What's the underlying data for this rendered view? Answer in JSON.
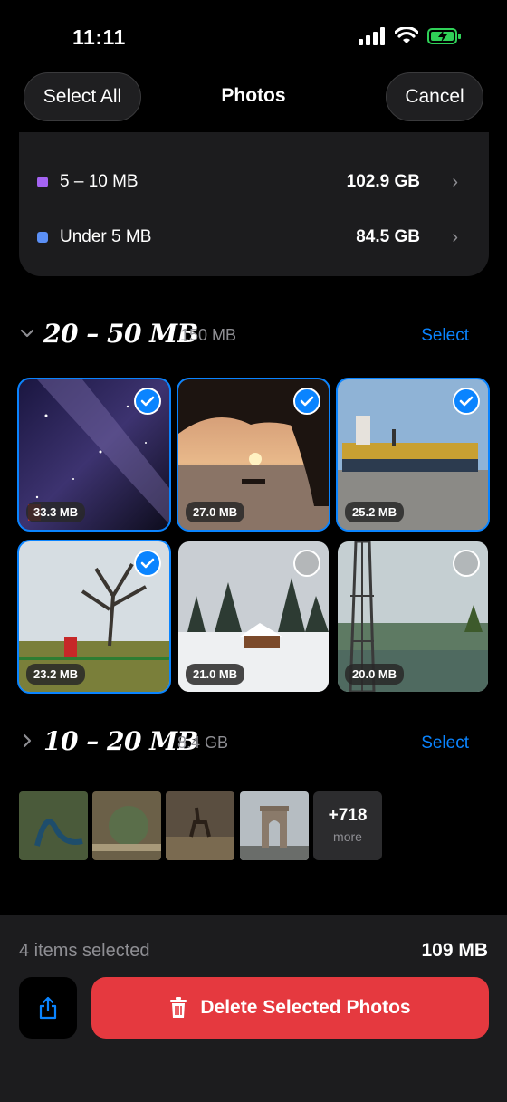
{
  "status": {
    "time": "11:11"
  },
  "nav": {
    "select_all": "Select All",
    "title": "Photos",
    "cancel": "Cancel"
  },
  "summary": [
    {
      "label": "5 – 10 MB",
      "value": "102.9 GB",
      "color": "#a463f2"
    },
    {
      "label": "Under 5 MB",
      "value": "84.5 GB",
      "color": "#5b8ff5"
    }
  ],
  "section_20_50": {
    "title": "20 – 50 MB",
    "size": "150 MB",
    "select_label": "Select",
    "photos": [
      {
        "size": "33.3 MB",
        "selected": true,
        "icon": "milky-way-photo"
      },
      {
        "size": "27.0 MB",
        "selected": true,
        "icon": "sunset-lake-photo"
      },
      {
        "size": "25.2 MB",
        "selected": true,
        "icon": "ship-photo"
      },
      {
        "size": "23.2 MB",
        "selected": true,
        "icon": "winter-tree-photo"
      },
      {
        "size": "21.0 MB",
        "selected": false,
        "icon": "snow-cabin-photo"
      },
      {
        "size": "20.0 MB",
        "selected": false,
        "icon": "power-line-lake-photo"
      }
    ]
  },
  "section_10_20": {
    "title": "10 – 20 MB",
    "size": "8.4 GB",
    "select_label": "Select",
    "more_count": "+718",
    "more_label": "more"
  },
  "bottom": {
    "selected_count": "4 items selected",
    "selected_size": "109 MB",
    "delete_label": "Delete Selected Photos"
  },
  "colors": {
    "accent": "#0a84ff",
    "danger": "#e5393f"
  }
}
